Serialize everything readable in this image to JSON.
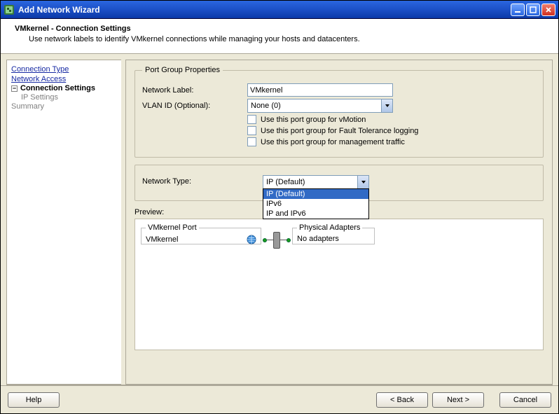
{
  "window": {
    "title": "Add Network Wizard"
  },
  "header": {
    "title": "VMkernel - Connection Settings",
    "subtitle": "Use network labels to identify VMkernel connections while managing your hosts and datacenters."
  },
  "sidebar": {
    "connection_type": "Connection Type",
    "network_access": "Network Access",
    "connection_settings": "Connection Settings",
    "ip_settings": "IP Settings",
    "summary": "Summary"
  },
  "portgroup": {
    "legend": "Port Group Properties",
    "network_label_lbl": "Network Label:",
    "network_label_value": "VMkernel",
    "vlan_lbl": "VLAN ID (Optional):",
    "vlan_value": "None (0)",
    "cb_vmotion": "Use this port group for vMotion",
    "cb_ft": "Use this port group for Fault Tolerance logging",
    "cb_mgmt": "Use this port group for management traffic"
  },
  "nettype": {
    "label": "Network Type:",
    "selected": "IP (Default)",
    "options": [
      "IP (Default)",
      "IPv6",
      "IP and IPv6"
    ]
  },
  "preview": {
    "label": "Preview:",
    "vmkernel_port_legend": "VMkernel Port",
    "vmkernel_port_value": "VMkernel",
    "phy_legend": "Physical Adapters",
    "phy_value": "No adapters"
  },
  "footer": {
    "help": "Help",
    "back": "< Back",
    "next": "Next >",
    "cancel": "Cancel"
  }
}
